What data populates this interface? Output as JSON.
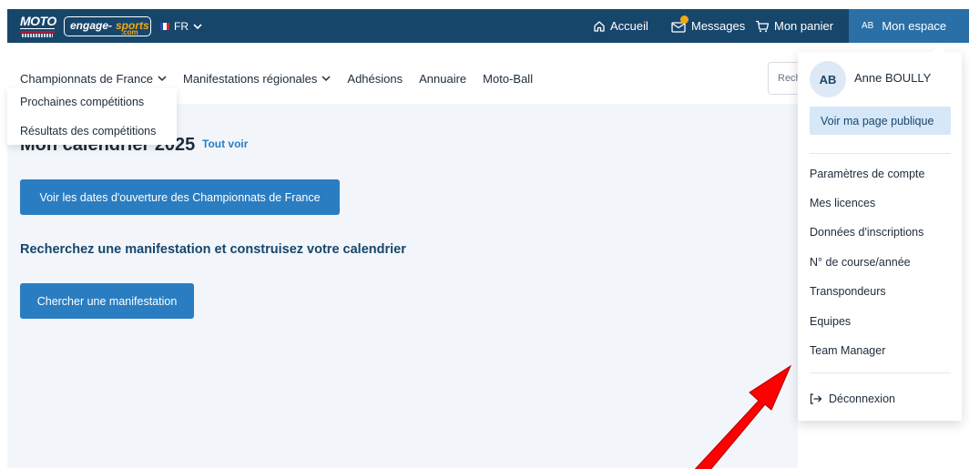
{
  "brand": {
    "moto_text": "MOTO",
    "engage_text": "engage-",
    "sports_text": "sports",
    "com_text": ".com"
  },
  "language": {
    "code": "FR"
  },
  "header": {
    "accueil": "Accueil",
    "messages": "Messages",
    "panier": "Mon panier",
    "espace_initials": "AB",
    "espace_label": "Mon espace"
  },
  "main_nav": [
    {
      "label": "Championnats de France",
      "has_dropdown": true
    },
    {
      "label": "Manifestations régionales",
      "has_dropdown": true
    },
    {
      "label": "Adhésions",
      "has_dropdown": false
    },
    {
      "label": "Annuaire",
      "has_dropdown": false
    },
    {
      "label": "Moto-Ball",
      "has_dropdown": false
    }
  ],
  "search": {
    "partial_text": "Rech"
  },
  "championnats_dropdown": [
    "Prochaines compétitions",
    "Résultats des compétitions"
  ],
  "calendar": {
    "title": "Mon calendrier 2025",
    "see_all": "Tout voir",
    "dates_button": "Voir les dates d'ouverture des Championnats de France",
    "search_heading": "Recherchez une manifestation et construisez votre calendrier",
    "search_button": "Chercher une manifestation"
  },
  "user_menu": {
    "initials": "AB",
    "name": "Anne BOULLY",
    "public_page": "Voir ma page publique",
    "items": [
      "Paramètres de compte",
      "Mes licences",
      "Données d'inscriptions",
      "N° de course/année",
      "Transpondeurs",
      "Equipes",
      "Team Manager"
    ],
    "logout": "Déconnexion"
  },
  "colors": {
    "topbar": "#17466b",
    "accent": "#2a7dc1",
    "content_bg": "#f2f6fb",
    "annotation_arrow": "#ff0000"
  }
}
